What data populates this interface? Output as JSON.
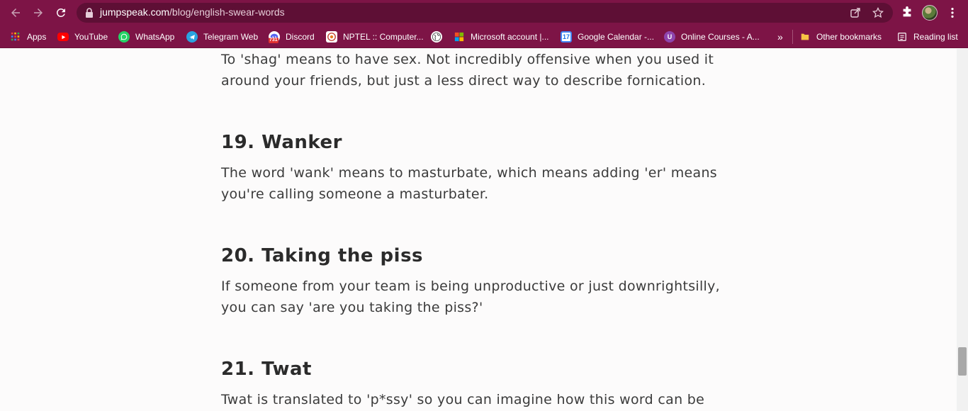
{
  "browser": {
    "url_host": "jumpspeak.com",
    "url_path": "/blog/english-swear-words",
    "bookmarks": [
      {
        "label": "Apps",
        "icon": "apps-grid-icon"
      },
      {
        "label": "YouTube",
        "icon": "youtube-icon"
      },
      {
        "label": "WhatsApp",
        "icon": "whatsapp-icon"
      },
      {
        "label": "Telegram Web",
        "icon": "telegram-icon"
      },
      {
        "label": "Discord",
        "icon": "discord-icon",
        "badge": "731"
      },
      {
        "label": "NPTEL :: Computer...",
        "icon": "nptel-icon"
      },
      {
        "label": "",
        "icon": "globe-icon"
      },
      {
        "label": "Microsoft account |...",
        "icon": "microsoft-icon"
      },
      {
        "label": "Google Calendar -...",
        "icon": "calendar-icon",
        "badge": "17"
      },
      {
        "label": "Online Courses - A...",
        "icon": "courses-icon"
      }
    ],
    "more_bookmarks": "»",
    "other_bookmarks": "Other bookmarks",
    "reading_list": "Reading list",
    "colors": {
      "chrome": "#7d1446",
      "omnibox": "#5e0f35"
    }
  },
  "article": {
    "intro_text": "To 'shag' means to have sex. Not incredibly offensive when you used it around your friends, but just a less direct way to describe fornication.",
    "sections": [
      {
        "heading": "19. Wanker",
        "body": "The word 'wank' means to masturbate, which means adding 'er' means you're calling someone a masturbater."
      },
      {
        "heading": "20. Taking the piss",
        "body": "If someone from your team is being unproductive or just downrightsilly, you can say 'are you taking the piss?'"
      },
      {
        "heading": "21. Twat",
        "body": "Twat is translated to 'p*ssy' so you can imagine how this word can be"
      }
    ]
  }
}
